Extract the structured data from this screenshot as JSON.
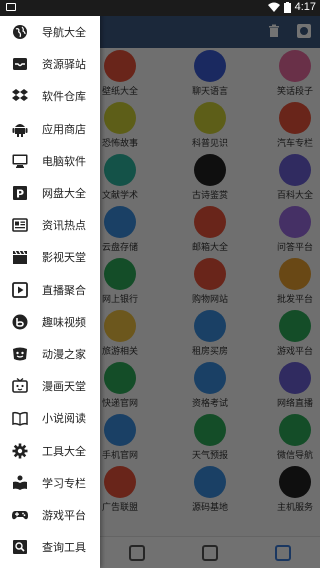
{
  "status": {
    "time": "4:17"
  },
  "drawer": {
    "items": [
      {
        "label": "导航大全",
        "icon": "globe-icon"
      },
      {
        "label": "资源驿站",
        "icon": "inbox-icon"
      },
      {
        "label": "软件仓库",
        "icon": "dropbox-icon"
      },
      {
        "label": "应用商店",
        "icon": "android-icon"
      },
      {
        "label": "电脑软件",
        "icon": "desktop-icon"
      },
      {
        "label": "网盘大全",
        "icon": "p-square-icon"
      },
      {
        "label": "资讯热点",
        "icon": "newspaper-icon"
      },
      {
        "label": "影视天堂",
        "icon": "clapperboard-icon"
      },
      {
        "label": "直播聚合",
        "icon": "play-square-icon"
      },
      {
        "label": "趣味视频",
        "icon": "bilibili-circle-icon"
      },
      {
        "label": "动漫之家",
        "icon": "smile-face-icon"
      },
      {
        "label": "漫画天堂",
        "icon": "tv-face-icon"
      },
      {
        "label": "小说阅读",
        "icon": "book-icon"
      },
      {
        "label": "工具大全",
        "icon": "gear-icon"
      },
      {
        "label": "学习专栏",
        "icon": "reader-icon"
      },
      {
        "label": "游戏平台",
        "icon": "gamepad-icon"
      },
      {
        "label": "查询工具",
        "icon": "search-doc-icon"
      }
    ]
  },
  "grid": [
    [
      {
        "label": "壁纸大全",
        "color": "#e8533a"
      },
      {
        "label": "聊天语言",
        "color": "#3b5bd6"
      },
      {
        "label": "笑话段子",
        "color": "#e86aa0"
      }
    ],
    [
      {
        "label": "恐怖故事",
        "color": "#cfd136"
      },
      {
        "label": "科普见识",
        "color": "#cfd136"
      },
      {
        "label": "汽车专栏",
        "color": "#e8533a"
      }
    ],
    [
      {
        "label": "文献学术",
        "color": "#2eb5a0"
      },
      {
        "label": "古诗鉴赏",
        "color": "#222222"
      },
      {
        "label": "百科大全",
        "color": "#6a5fd6"
      }
    ],
    [
      {
        "label": "云盘存储",
        "color": "#3b8fe0"
      },
      {
        "label": "邮箱大全",
        "color": "#e8533a"
      },
      {
        "label": "问答平台",
        "color": "#9a6ae0"
      }
    ],
    [
      {
        "label": "网上银行",
        "color": "#2eaa5a"
      },
      {
        "label": "购物网站",
        "color": "#e8533a"
      },
      {
        "label": "批发平台",
        "color": "#e8a030"
      }
    ],
    [
      {
        "label": "旅游相关",
        "color": "#f0c040"
      },
      {
        "label": "租房买房",
        "color": "#3b8fe0"
      },
      {
        "label": "游戏平台",
        "color": "#2eaa5a"
      }
    ],
    [
      {
        "label": "快递官网",
        "color": "#2eaa5a"
      },
      {
        "label": "资格考试",
        "color": "#3b8fe0"
      },
      {
        "label": "网络直播",
        "color": "#6a5fd6"
      }
    ],
    [
      {
        "label": "手机官网",
        "color": "#3b8fe0"
      },
      {
        "label": "天气预报",
        "color": "#2eaa5a"
      },
      {
        "label": "微信导航",
        "color": "#2eaa5a"
      }
    ],
    [
      {
        "label": "广告联盟",
        "color": "#e8533a"
      },
      {
        "label": "源码基地",
        "color": "#3b8fe0"
      },
      {
        "label": "主机服务",
        "color": "#222222"
      }
    ]
  ]
}
